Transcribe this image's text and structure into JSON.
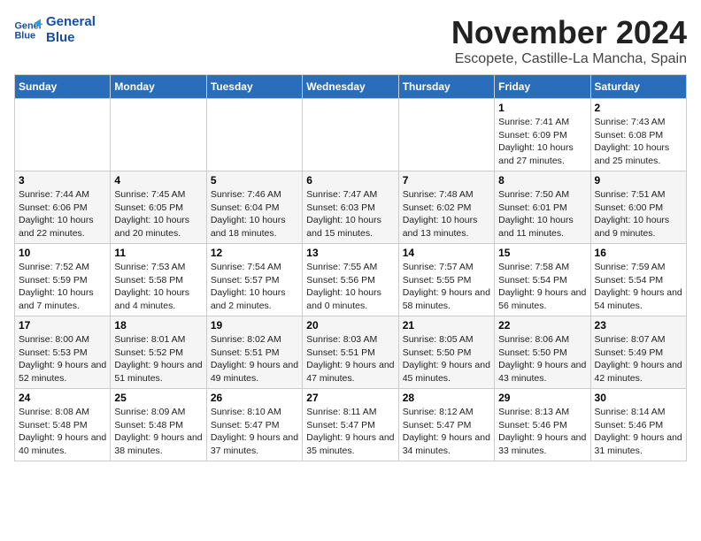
{
  "header": {
    "logo_line1": "General",
    "logo_line2": "Blue",
    "month_title": "November 2024",
    "location": "Escopete, Castille-La Mancha, Spain"
  },
  "weekdays": [
    "Sunday",
    "Monday",
    "Tuesday",
    "Wednesday",
    "Thursday",
    "Friday",
    "Saturday"
  ],
  "weeks": [
    [
      {
        "day": "",
        "info": ""
      },
      {
        "day": "",
        "info": ""
      },
      {
        "day": "",
        "info": ""
      },
      {
        "day": "",
        "info": ""
      },
      {
        "day": "",
        "info": ""
      },
      {
        "day": "1",
        "info": "Sunrise: 7:41 AM\nSunset: 6:09 PM\nDaylight: 10 hours and 27 minutes."
      },
      {
        "day": "2",
        "info": "Sunrise: 7:43 AM\nSunset: 6:08 PM\nDaylight: 10 hours and 25 minutes."
      }
    ],
    [
      {
        "day": "3",
        "info": "Sunrise: 7:44 AM\nSunset: 6:06 PM\nDaylight: 10 hours and 22 minutes."
      },
      {
        "day": "4",
        "info": "Sunrise: 7:45 AM\nSunset: 6:05 PM\nDaylight: 10 hours and 20 minutes."
      },
      {
        "day": "5",
        "info": "Sunrise: 7:46 AM\nSunset: 6:04 PM\nDaylight: 10 hours and 18 minutes."
      },
      {
        "day": "6",
        "info": "Sunrise: 7:47 AM\nSunset: 6:03 PM\nDaylight: 10 hours and 15 minutes."
      },
      {
        "day": "7",
        "info": "Sunrise: 7:48 AM\nSunset: 6:02 PM\nDaylight: 10 hours and 13 minutes."
      },
      {
        "day": "8",
        "info": "Sunrise: 7:50 AM\nSunset: 6:01 PM\nDaylight: 10 hours and 11 minutes."
      },
      {
        "day": "9",
        "info": "Sunrise: 7:51 AM\nSunset: 6:00 PM\nDaylight: 10 hours and 9 minutes."
      }
    ],
    [
      {
        "day": "10",
        "info": "Sunrise: 7:52 AM\nSunset: 5:59 PM\nDaylight: 10 hours and 7 minutes."
      },
      {
        "day": "11",
        "info": "Sunrise: 7:53 AM\nSunset: 5:58 PM\nDaylight: 10 hours and 4 minutes."
      },
      {
        "day": "12",
        "info": "Sunrise: 7:54 AM\nSunset: 5:57 PM\nDaylight: 10 hours and 2 minutes."
      },
      {
        "day": "13",
        "info": "Sunrise: 7:55 AM\nSunset: 5:56 PM\nDaylight: 10 hours and 0 minutes."
      },
      {
        "day": "14",
        "info": "Sunrise: 7:57 AM\nSunset: 5:55 PM\nDaylight: 9 hours and 58 minutes."
      },
      {
        "day": "15",
        "info": "Sunrise: 7:58 AM\nSunset: 5:54 PM\nDaylight: 9 hours and 56 minutes."
      },
      {
        "day": "16",
        "info": "Sunrise: 7:59 AM\nSunset: 5:54 PM\nDaylight: 9 hours and 54 minutes."
      }
    ],
    [
      {
        "day": "17",
        "info": "Sunrise: 8:00 AM\nSunset: 5:53 PM\nDaylight: 9 hours and 52 minutes."
      },
      {
        "day": "18",
        "info": "Sunrise: 8:01 AM\nSunset: 5:52 PM\nDaylight: 9 hours and 51 minutes."
      },
      {
        "day": "19",
        "info": "Sunrise: 8:02 AM\nSunset: 5:51 PM\nDaylight: 9 hours and 49 minutes."
      },
      {
        "day": "20",
        "info": "Sunrise: 8:03 AM\nSunset: 5:51 PM\nDaylight: 9 hours and 47 minutes."
      },
      {
        "day": "21",
        "info": "Sunrise: 8:05 AM\nSunset: 5:50 PM\nDaylight: 9 hours and 45 minutes."
      },
      {
        "day": "22",
        "info": "Sunrise: 8:06 AM\nSunset: 5:50 PM\nDaylight: 9 hours and 43 minutes."
      },
      {
        "day": "23",
        "info": "Sunrise: 8:07 AM\nSunset: 5:49 PM\nDaylight: 9 hours and 42 minutes."
      }
    ],
    [
      {
        "day": "24",
        "info": "Sunrise: 8:08 AM\nSunset: 5:48 PM\nDaylight: 9 hours and 40 minutes."
      },
      {
        "day": "25",
        "info": "Sunrise: 8:09 AM\nSunset: 5:48 PM\nDaylight: 9 hours and 38 minutes."
      },
      {
        "day": "26",
        "info": "Sunrise: 8:10 AM\nSunset: 5:47 PM\nDaylight: 9 hours and 37 minutes."
      },
      {
        "day": "27",
        "info": "Sunrise: 8:11 AM\nSunset: 5:47 PM\nDaylight: 9 hours and 35 minutes."
      },
      {
        "day": "28",
        "info": "Sunrise: 8:12 AM\nSunset: 5:47 PM\nDaylight: 9 hours and 34 minutes."
      },
      {
        "day": "29",
        "info": "Sunrise: 8:13 AM\nSunset: 5:46 PM\nDaylight: 9 hours and 33 minutes."
      },
      {
        "day": "30",
        "info": "Sunrise: 8:14 AM\nSunset: 5:46 PM\nDaylight: 9 hours and 31 minutes."
      }
    ]
  ]
}
